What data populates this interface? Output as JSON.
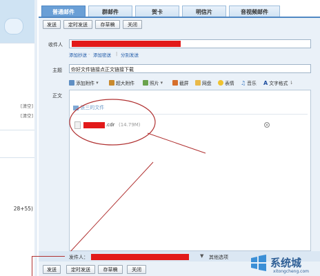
{
  "tabs": [
    "普通邮件",
    "群邮件",
    "贺卡",
    "明信片",
    "音视频邮件"
  ],
  "toolbar": {
    "send": "发送",
    "timed_send": "定时发送",
    "save_draft": "存草稿",
    "close": "关闭"
  },
  "form": {
    "to_label": "收件人",
    "cc_links": [
      "添加抄送",
      "添加密送",
      "分别发送"
    ],
    "subject_label": "主题",
    "subject_value": "你好文件链接点正文链接下载",
    "body_label": "正文"
  },
  "editor_tools": [
    "添加附件",
    "超大附件",
    "照片",
    "截屏",
    "网盘",
    "表情",
    "音乐",
    "文字格式"
  ],
  "attachment": {
    "header": "张三的文件",
    "file_ext": ".cdr",
    "file_size": "(14.79M)"
  },
  "footer": {
    "sender_label": "发件人：",
    "other_options": "其他选项"
  },
  "sidebar": {
    "clear1": "[清空]",
    "clear2": "[清空]",
    "formula": "28+55)"
  },
  "watermark": {
    "name": "系统城",
    "url": "xitongcheng.com"
  },
  "colors": {
    "accent": "#4f87c3",
    "redaction": "#e21a1a",
    "annotation": "#b03030"
  }
}
